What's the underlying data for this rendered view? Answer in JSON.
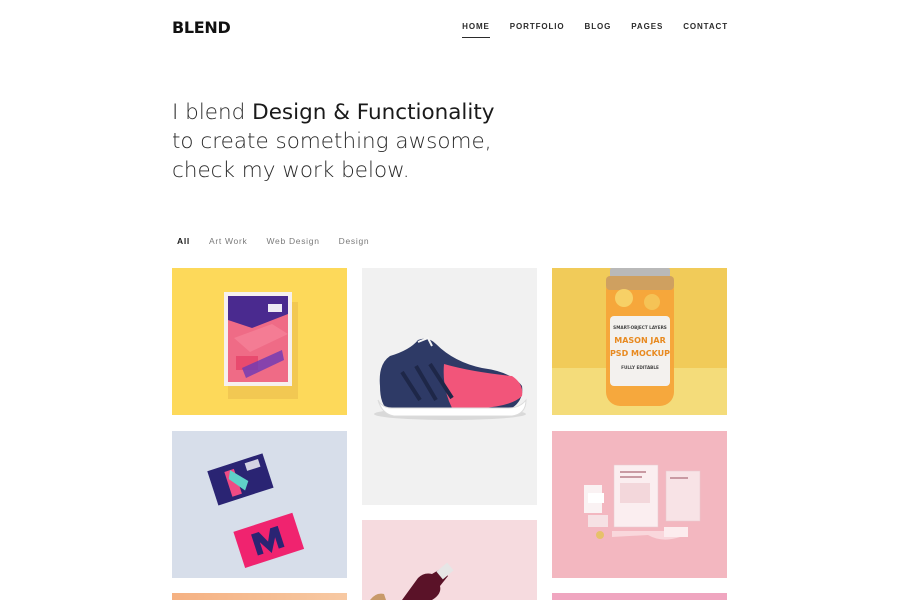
{
  "header": {
    "logo": "BLEND",
    "nav": [
      {
        "label": "HOME",
        "active": true
      },
      {
        "label": "PORTFOLIO",
        "active": false
      },
      {
        "label": "BLOG",
        "active": false
      },
      {
        "label": "PAGES",
        "active": false
      },
      {
        "label": "CONTACT",
        "active": false
      }
    ]
  },
  "hero": {
    "line1_prefix": "I blend ",
    "line1_strong": "Design & Functionality",
    "line2": "to create something awsome,",
    "line3": "check my work below."
  },
  "filters": [
    {
      "label": "All",
      "active": true
    },
    {
      "label": "Art Work",
      "active": false
    },
    {
      "label": "Web Design",
      "active": false
    },
    {
      "label": "Design",
      "active": false
    }
  ],
  "portfolio": {
    "items": [
      {
        "name": "poster-mockup",
        "bg": "#fdd95a"
      },
      {
        "name": "sneaker",
        "bg": "#f1f1f1"
      },
      {
        "name": "mason-jar-mockup",
        "bg": "#f1cb59",
        "jar_label_top": "SMART-OBJECT LAYERS",
        "jar_label_title1": "MASON JAR",
        "jar_label_title2": "PSD MOCKUP",
        "jar_label_bottom": "FULLY EDITABLE"
      },
      {
        "name": "business-cards",
        "bg": "#d7deea"
      },
      {
        "name": "wine-bottle",
        "bg": "#f6dbdf"
      },
      {
        "name": "stationery-mockup",
        "bg": "#f3b7c0"
      }
    ]
  }
}
